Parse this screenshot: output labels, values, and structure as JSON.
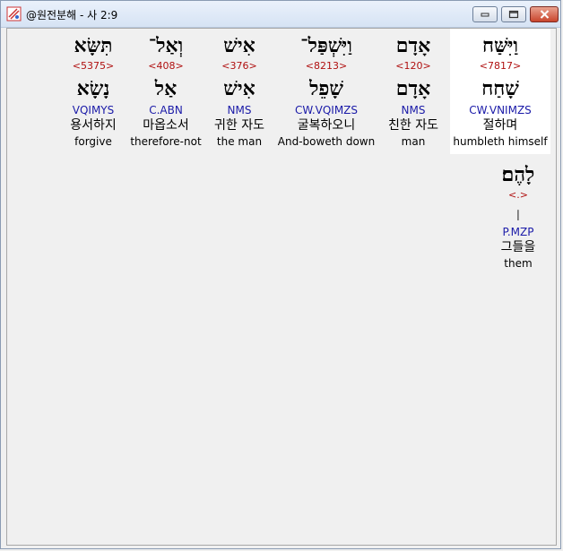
{
  "window": {
    "title": "@원전분해 - 사 2:9",
    "buttons": {
      "minimize": "▭",
      "maximize": "□",
      "close": "✕"
    }
  },
  "words": [
    {
      "hebrew": "וַיִּשַּׁח",
      "strong": "<7817>",
      "lemma": "שָׁחַח",
      "parse": "CW.VNIMZS",
      "korean": "절하며",
      "english": "humbleth himself"
    },
    {
      "hebrew": "אָדָם",
      "strong": "<120>",
      "lemma": "אָדָם",
      "parse": "NMS",
      "korean": "친한 자도",
      "english": "man"
    },
    {
      "hebrew": "וַיִּשְׁפַּל־",
      "strong": "<8213>",
      "lemma": "שָׁפֵל",
      "parse": "CW.VQIMZS",
      "korean": "굴복하오니",
      "english": "And-boweth down"
    },
    {
      "hebrew": "אִישׁ",
      "strong": "<376>",
      "lemma": "אִישׁ",
      "parse": "NMS",
      "korean": "귀한 자도",
      "english": "the man"
    },
    {
      "hebrew": "וְאַל־",
      "strong": "<408>",
      "lemma": "אַל",
      "parse": "C.ABN",
      "korean": "마옵소서",
      "english": "therefore-not"
    },
    {
      "hebrew": "תִּשָּׂא",
      "strong": "<5375>",
      "lemma": "נָשָׂא",
      "parse": "VQIMYS",
      "korean": "용서하지",
      "english": "forgive"
    }
  ],
  "word_row2": {
    "hebrew": "לָהֶם׃",
    "strong": "<.>",
    "lemma": "׀",
    "parse": "P.MZP",
    "korean": "그들을",
    "english": "them"
  }
}
